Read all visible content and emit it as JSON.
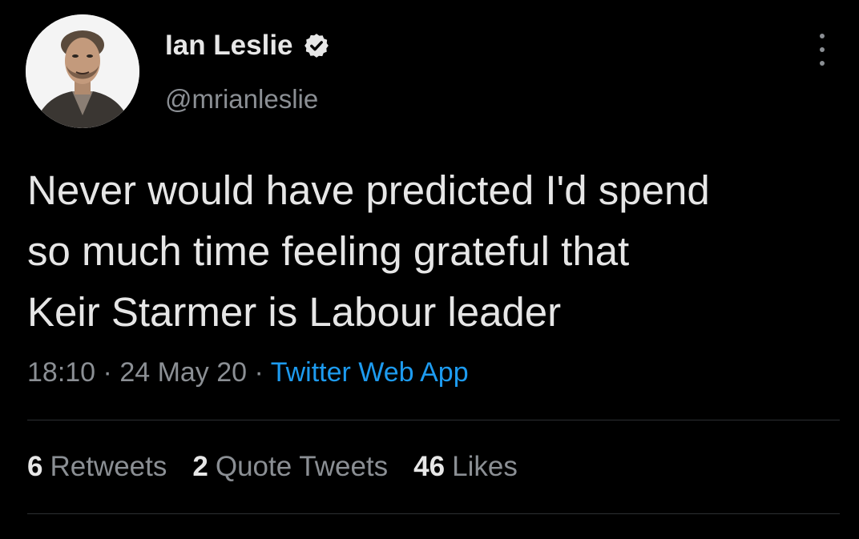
{
  "user": {
    "display_name": "Ian Leslie",
    "handle": "@mrianleslie",
    "verified_icon": "verified-badge-icon",
    "avatar_icon": "profile-photo"
  },
  "tweet": {
    "lines": [
      "Never would have predicted I'd spend",
      "so much time feeling grateful that",
      "Keir Starmer is Labour leader"
    ]
  },
  "meta": {
    "time": "18:10",
    "separator": " · ",
    "date": "24 May 20",
    "source": "Twitter Web App"
  },
  "stats": {
    "retweets_count": "6",
    "retweets_label": "Retweets",
    "quotes_count": "2",
    "quotes_label": "Quote Tweets",
    "likes_count": "46",
    "likes_label": "Likes"
  },
  "colors": {
    "background": "#000000",
    "text": "#e6e6e6",
    "secondary": "#8b8f94",
    "link": "#1d9bf0"
  }
}
